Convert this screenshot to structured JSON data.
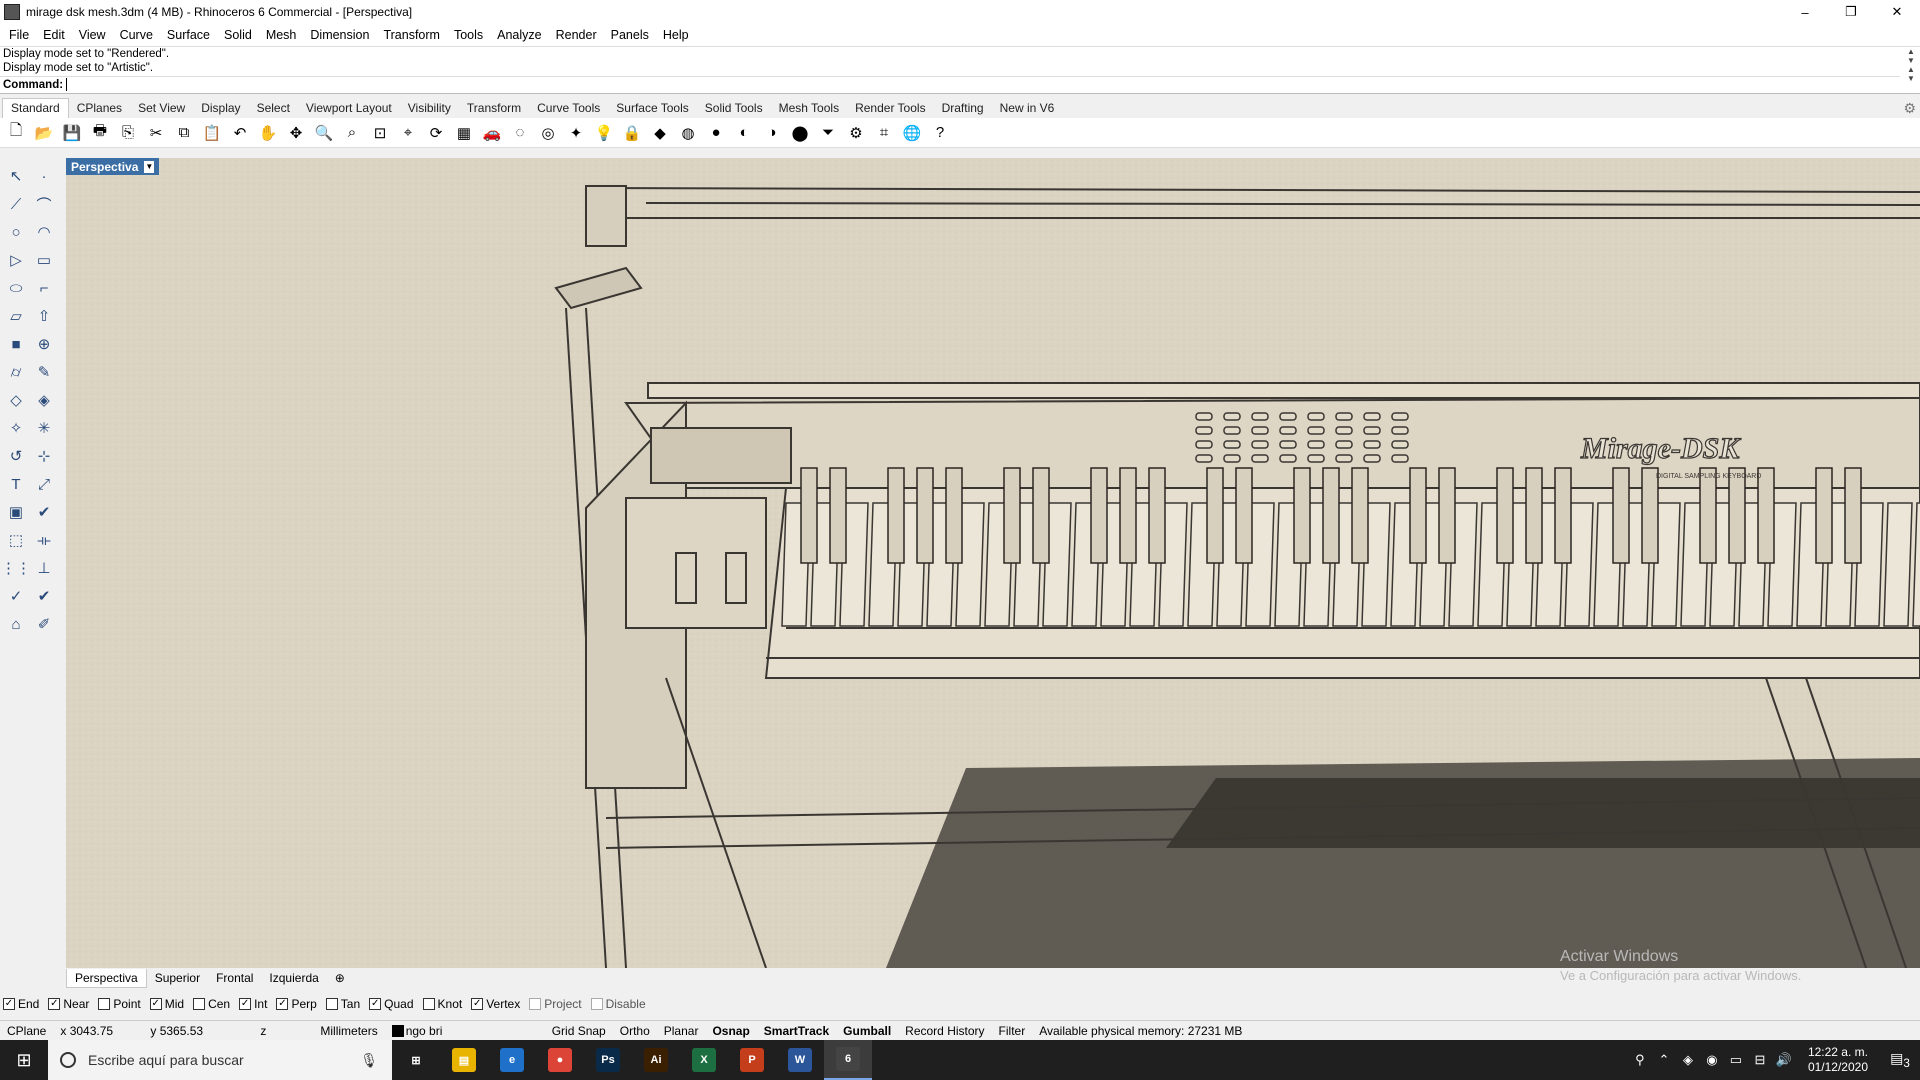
{
  "window": {
    "title": "mirage dsk mesh.3dm (4 MB) - Rhinoceros 6 Commercial - [Perspectiva]",
    "minimize": "–",
    "restore": "❐",
    "close": "✕"
  },
  "menu": [
    "File",
    "Edit",
    "View",
    "Curve",
    "Surface",
    "Solid",
    "Mesh",
    "Dimension",
    "Transform",
    "Tools",
    "Analyze",
    "Render",
    "Panels",
    "Help"
  ],
  "command": {
    "history": [
      "Display mode set to \"Rendered\".",
      "Display mode set to \"Artistic\"."
    ],
    "prompt": "Command:",
    "value": ""
  },
  "toolbar_tabs": [
    "Standard",
    "CPlanes",
    "Set View",
    "Display",
    "Select",
    "Viewport Layout",
    "Visibility",
    "Transform",
    "Curve Tools",
    "Surface Tools",
    "Solid Tools",
    "Mesh Tools",
    "Render Tools",
    "Drafting",
    "New in V6"
  ],
  "active_toolbar_tab": "Standard",
  "toolbar_icons": [
    "new-file-icon",
    "open-folder-icon",
    "save-icon",
    "print-icon",
    "import-icon",
    "cut-icon",
    "copy-icon",
    "paste-icon",
    "undo-icon",
    "pan-hand-icon",
    "rotate-view-icon",
    "zoom-icon",
    "zoom-window-icon",
    "zoom-extents-icon",
    "zoom-selected-icon",
    "rotate-icon",
    "viewport-grid-icon",
    "car-icon",
    "hide-icon",
    "show-icon",
    "lock-lights-icon",
    "light-bulb-icon",
    "lock-icon",
    "layer-icon",
    "color-wheel-icon",
    "sphere-icon",
    "shaded-sphere-icon",
    "rendered-sphere-icon",
    "material-sphere-icon",
    "filter-icon",
    "gear-options-icon",
    "cplane-icon",
    "globe-icon",
    "help-icon"
  ],
  "left_tools": [
    "select-icon",
    "point-icon",
    "polyline-icon",
    "curve-icon",
    "circle-icon",
    "arc-icon",
    "polygon-icon",
    "rectangle-icon",
    "ellipse-icon",
    "fillet-curve-icon",
    "surface-icon",
    "extrude-icon",
    "box-icon",
    "boolean-icon",
    "cylinder-icon",
    "surface-edit-icon",
    "mesh-icon",
    "light-icon",
    "transform-icon",
    "explode-icon",
    "rebuild-icon",
    "edit-points-icon",
    "text-icon",
    "scale-icon",
    "group-icon",
    "analyze-icon",
    "block-icon",
    "dimension-icon",
    "array-icon",
    "align-icon",
    "check-icon",
    "checkmark-icon",
    "render-material-icon",
    "paint-icon"
  ],
  "viewport": {
    "label": "Perspectiva",
    "model_text": "Mirage-DSK",
    "model_subtext": "DIGITAL   SAMPLING   KEYBOARD"
  },
  "viewport_tabs": [
    "Perspectiva",
    "Superior",
    "Frontal",
    "Izquierda"
  ],
  "osnaps": [
    {
      "label": "End",
      "checked": true
    },
    {
      "label": "Near",
      "checked": true
    },
    {
      "label": "Point",
      "checked": false
    },
    {
      "label": "Mid",
      "checked": true
    },
    {
      "label": "Cen",
      "checked": false
    },
    {
      "label": "Int",
      "checked": true
    },
    {
      "label": "Perp",
      "checked": true
    },
    {
      "label": "Tan",
      "checked": false
    },
    {
      "label": "Quad",
      "checked": true
    },
    {
      "label": "Knot",
      "checked": false
    },
    {
      "label": "Vertex",
      "checked": true
    },
    {
      "label": "Project",
      "checked": false,
      "disabled": true
    },
    {
      "label": "Disable",
      "checked": false,
      "disabled": true
    }
  ],
  "status": {
    "cplane": "CPlane",
    "x": "x 3043.75",
    "y": "y 5365.53",
    "z": "z",
    "units": "Millimeters",
    "layer": "ngo bri",
    "toggles": [
      {
        "label": "Grid Snap",
        "bold": false
      },
      {
        "label": "Ortho",
        "bold": false
      },
      {
        "label": "Planar",
        "bold": false
      },
      {
        "label": "Osnap",
        "bold": true
      },
      {
        "label": "SmartTrack",
        "bold": true
      },
      {
        "label": "Gumball",
        "bold": true
      },
      {
        "label": "Record History",
        "bold": false
      },
      {
        "label": "Filter",
        "bold": false
      }
    ],
    "memory": "Available physical memory: 27231 MB"
  },
  "watermark": {
    "line1": "Activar Windows",
    "line2": "Ve a Configuración para activar Windows."
  },
  "taskbar": {
    "search_placeholder": "Escribe aquí para buscar",
    "apps": [
      {
        "name": "task-view",
        "label": "⊞",
        "color": "#1f1f1f"
      },
      {
        "name": "file-explorer",
        "label": "▤",
        "color": "#e8b400"
      },
      {
        "name": "edge",
        "label": "e",
        "color": "#1e70c8"
      },
      {
        "name": "chrome",
        "label": "●",
        "color": "#db4437"
      },
      {
        "name": "photoshop",
        "label": "Ps",
        "color": "#0a2a4a"
      },
      {
        "name": "illustrator",
        "label": "Ai",
        "color": "#3a1f00"
      },
      {
        "name": "excel",
        "label": "X",
        "color": "#1d6f42"
      },
      {
        "name": "powerpoint",
        "label": "P",
        "color": "#c43e1c"
      },
      {
        "name": "word",
        "label": "W",
        "color": "#2b579a"
      },
      {
        "name": "rhino",
        "label": "6",
        "color": "#444444"
      }
    ],
    "time": "12:22 a. m.",
    "date": "01/12/2020",
    "notifications": "3"
  }
}
